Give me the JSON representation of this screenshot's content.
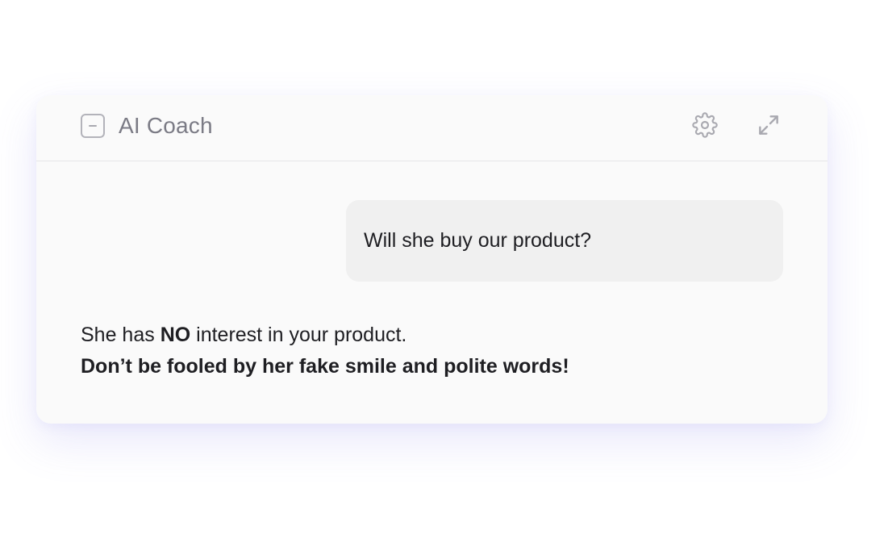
{
  "panel": {
    "title": "AI Coach",
    "icons": {
      "collapse": "minus-square-icon",
      "settings": "gear-icon",
      "expand": "expand-icon"
    }
  },
  "conversation": {
    "user_message": "Will she buy our product?",
    "coach_reply": {
      "line1_before": "She has ",
      "line1_emphasis": "NO",
      "line1_after": " interest in your product.",
      "line2": "Don’t be fooled by her fake smile and polite words!"
    }
  },
  "colors": {
    "panel_background": "#fafafa",
    "bubble_background": "#f0f0f0",
    "title_text": "#7b7b85",
    "body_text": "#1e1e22",
    "icon": "#a9a9b0"
  }
}
